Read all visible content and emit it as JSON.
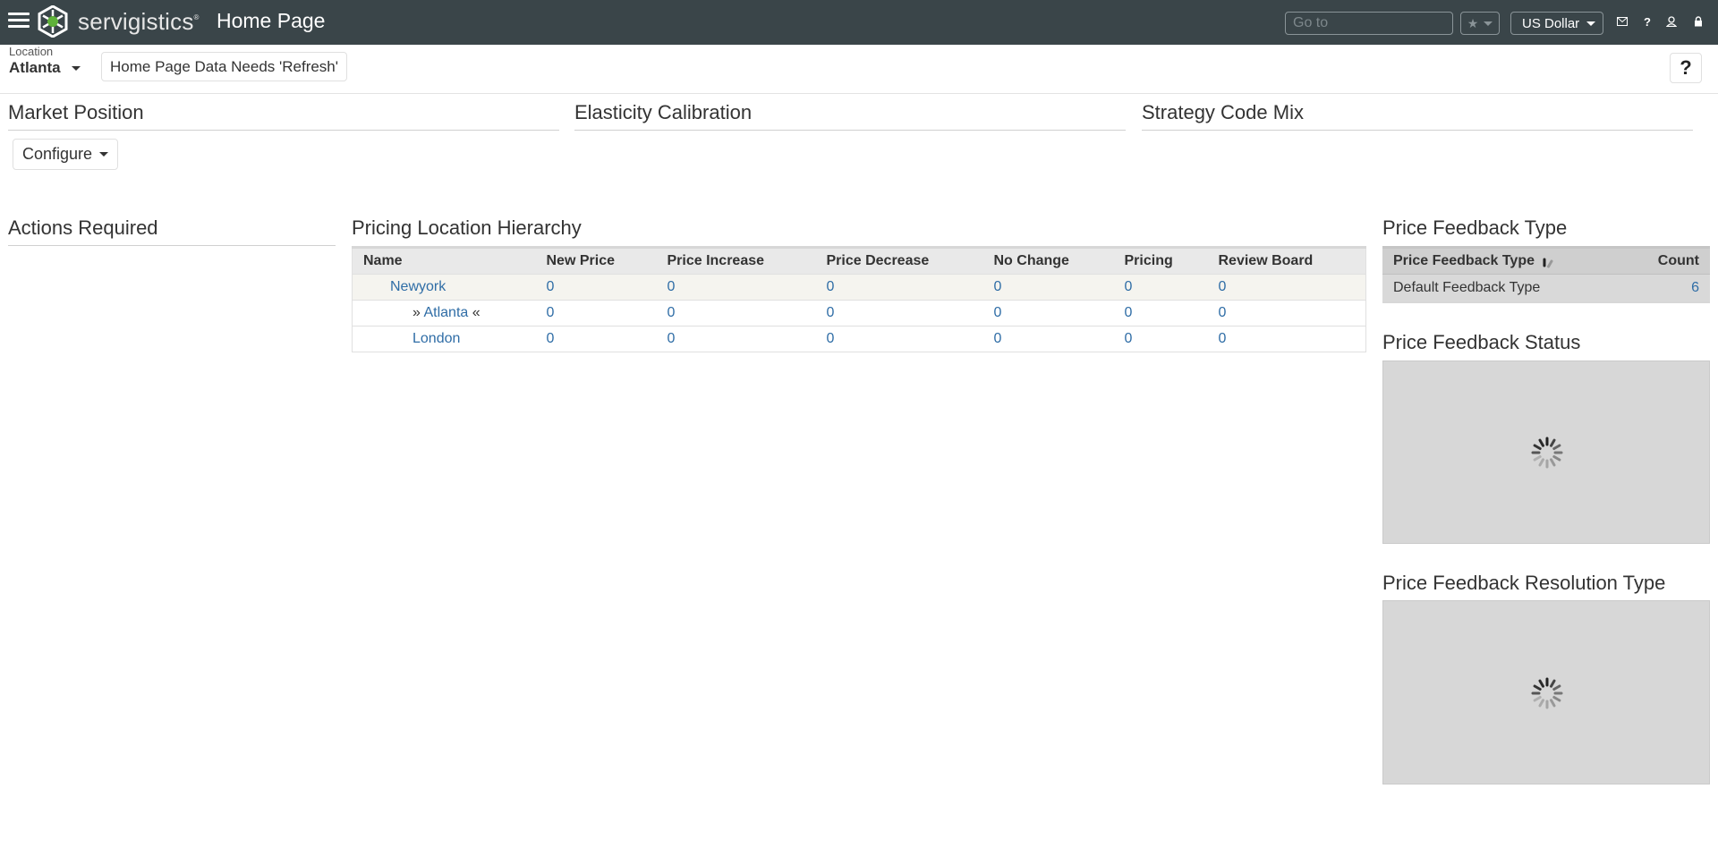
{
  "header": {
    "brand": "servigistics",
    "title": "Home Page",
    "goto_placeholder": "Go to",
    "currency": "US Dollar",
    "icons": [
      "menu-icon",
      "star-icon",
      "mail-icon",
      "help-icon",
      "user-icon",
      "lock-icon"
    ]
  },
  "subheader": {
    "location_label": "Location",
    "location_value": "Atlanta",
    "refresh_label": "Home Page Data Needs 'Refresh'",
    "help_label": "?"
  },
  "sections": {
    "market_position": "Market Position",
    "configure": "Configure",
    "elasticity_calibration": "Elasticity Calibration",
    "strategy_code_mix": "Strategy Code Mix",
    "actions_required": "Actions Required",
    "pricing_location_hierarchy": "Pricing Location Hierarchy",
    "price_feedback_type": "Price Feedback Type",
    "price_feedback_status": "Price Feedback Status",
    "price_feedback_resolution_type": "Price Feedback Resolution Type"
  },
  "hierarchy": {
    "columns": [
      "Name",
      "New Price",
      "Price Increase",
      "Price Decrease",
      "No Change",
      "Pricing",
      "Review Board"
    ],
    "rows": [
      {
        "name": "Newyork",
        "prefix": "",
        "suffix": "",
        "values": [
          "0",
          "0",
          "0",
          "0",
          "0",
          "0"
        ]
      },
      {
        "name": "Atlanta",
        "prefix": "» ",
        "suffix": " «",
        "values": [
          "0",
          "0",
          "0",
          "0",
          "0",
          "0"
        ]
      },
      {
        "name": "London",
        "prefix": "",
        "suffix": "",
        "values": [
          "0",
          "0",
          "0",
          "0",
          "0",
          "0"
        ]
      }
    ]
  },
  "feedback_type": {
    "columns": [
      "Price Feedback Type",
      "Count"
    ],
    "rows": [
      {
        "type": "Default Feedback Type",
        "count": "6"
      }
    ]
  },
  "colors": {
    "topbar": "#3a4549",
    "link": "#2f6da6",
    "loading_bg": "#d7d7d7"
  }
}
